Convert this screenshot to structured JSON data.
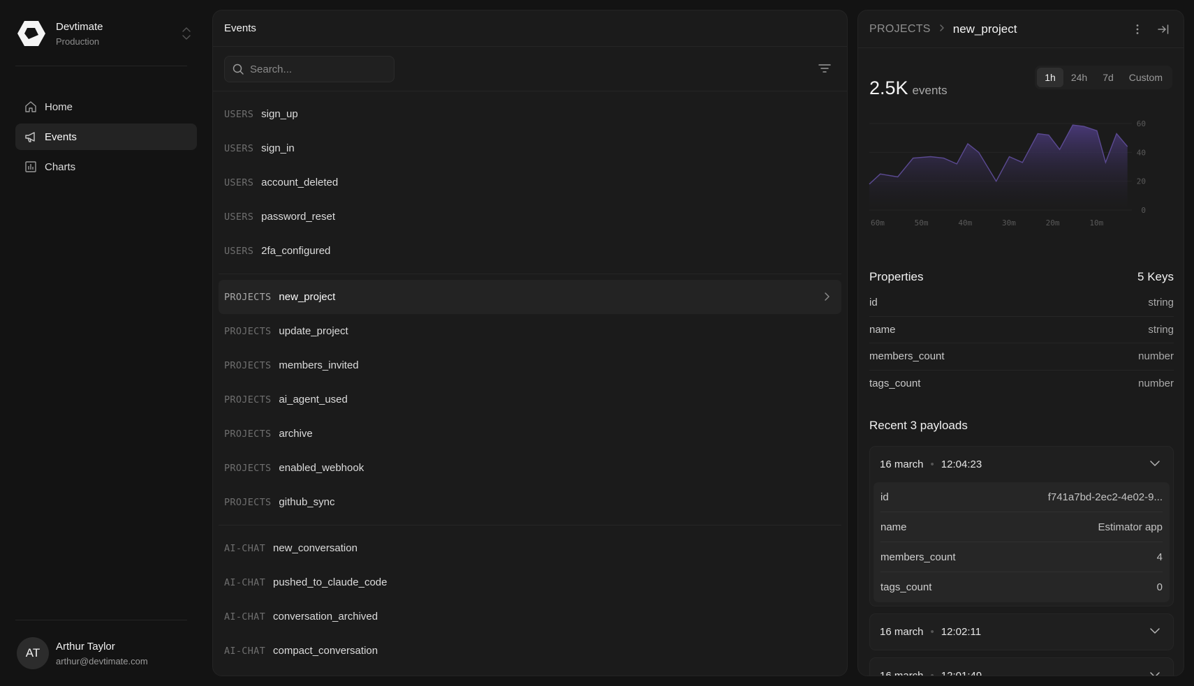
{
  "workspace": {
    "name": "Devtimate",
    "env": "Production"
  },
  "nav": [
    {
      "id": "home",
      "label": "Home",
      "icon": "home-icon"
    },
    {
      "id": "events",
      "label": "Events",
      "icon": "megaphone-icon",
      "active": true
    },
    {
      "id": "charts",
      "label": "Charts",
      "icon": "bar-chart-icon"
    }
  ],
  "user": {
    "initials": "AT",
    "name": "Arthur Taylor",
    "email": "arthur@devtimate.com"
  },
  "events": {
    "title": "Events",
    "search_placeholder": "Search...",
    "groups": [
      {
        "category": "USERS",
        "items": [
          "sign_up",
          "sign_in",
          "account_deleted",
          "password_reset",
          "2fa_configured"
        ]
      },
      {
        "category": "PROJECTS",
        "items": [
          "new_project",
          "update_project",
          "members_invited",
          "ai_agent_used",
          "archive",
          "enabled_webhook",
          "github_sync"
        ]
      },
      {
        "category": "AI-CHAT",
        "items": [
          "new_conversation",
          "pushed_to_claude_code",
          "conversation_archived",
          "compact_conversation"
        ]
      }
    ],
    "selected": {
      "category": "PROJECTS",
      "name": "new_project"
    }
  },
  "detail": {
    "breadcrumb_root": "PROJECTS",
    "breadcrumb_current": "new_project",
    "count": "2.5K",
    "count_unit": "events",
    "ranges": [
      "1h",
      "24h",
      "7d",
      "Custom"
    ],
    "selected_range": "1h",
    "properties_title": "Properties",
    "properties_count": "5 Keys",
    "properties": [
      {
        "key": "id",
        "type": "string"
      },
      {
        "key": "name",
        "type": "string"
      },
      {
        "key": "members_count",
        "type": "number"
      },
      {
        "key": "tags_count",
        "type": "number"
      }
    ],
    "recent_title": "Recent 3 payloads",
    "payloads": [
      {
        "date": "16 march",
        "time": "12:04:23",
        "expanded": true,
        "fields": [
          {
            "key": "id",
            "value": "f741a7bd-2ec2-4e02-9..."
          },
          {
            "key": "name",
            "value": "Estimator app"
          },
          {
            "key": "members_count",
            "value": "4"
          },
          {
            "key": "tags_count",
            "value": "0"
          }
        ]
      },
      {
        "date": "16 march",
        "time": "12:02:11",
        "expanded": false
      },
      {
        "date": "16 march",
        "time": "12:01:49",
        "expanded": false
      }
    ]
  },
  "colors": {
    "accent": "#4a3a7a",
    "accent_line": "#5b4a92",
    "bg": "#131313",
    "panel": "#1b1b1b"
  },
  "chart_data": {
    "type": "area",
    "x_ticks": [
      "60m",
      "50m",
      "40m",
      "30m",
      "20m",
      "10m"
    ],
    "y_ticks": [
      "60",
      "40",
      "20",
      "0"
    ],
    "ylim": [
      0,
      60
    ],
    "x_minutes_ago": [
      60,
      57.5,
      53.5,
      50,
      46,
      43,
      40,
      37.5,
      35,
      31,
      28,
      25,
      21.5,
      19,
      16.5,
      13.5,
      11,
      8,
      6,
      3.5,
      1
    ],
    "values": [
      18,
      25,
      23,
      36,
      37,
      36,
      32,
      46,
      40,
      20,
      37,
      33,
      53,
      52,
      42,
      59,
      58,
      55,
      33,
      53,
      44
    ],
    "grid": true
  }
}
